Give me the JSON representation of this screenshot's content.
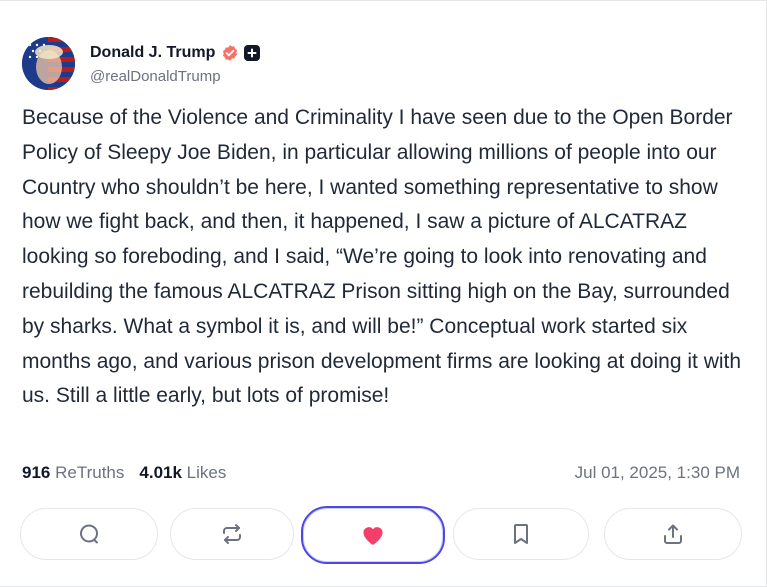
{
  "user": {
    "name": "Donald J. Trump",
    "handle": "@realDonaldTrump",
    "verified_icon": "verified-check-icon",
    "badge_icon": "plus-badge-icon",
    "verified_color": "#f97066"
  },
  "post": {
    "text": "Because of the Violence and Criminality I have seen due to the Open Border Policy of Sleepy Joe Biden, in particular allowing millions of people into our Country who shouldn’t be here, I wanted something representative to show how we fight back, and then, it happened, I saw a picture of ALCATRAZ looking so foreboding, and I said, “We’re going to look into renovating and rebuilding the famous ALCATRAZ Prison sitting high on the Bay, surrounded by sharks. What a symbol it is, and will be!” Conceptual work started six months ago, and various prison development firms are looking at doing it with us. Still a little early, but lots of promise!",
    "retruths_count": "916",
    "retruths_label": "ReTruths",
    "likes_count": "4.01k",
    "likes_label": "Likes",
    "timestamp": "Jul 01, 2025, 1:30 PM"
  },
  "actions": [
    {
      "name": "reply",
      "icon": "comment-icon"
    },
    {
      "name": "retruth",
      "icon": "repost-icon"
    },
    {
      "name": "like",
      "icon": "heart-icon",
      "active": true
    },
    {
      "name": "bookmark",
      "icon": "bookmark-icon"
    },
    {
      "name": "share",
      "icon": "share-icon"
    }
  ],
  "colors": {
    "accent": "#4f46e5",
    "like": "#f43f6b",
    "muted": "#6b7280",
    "text": "#1f2937"
  }
}
